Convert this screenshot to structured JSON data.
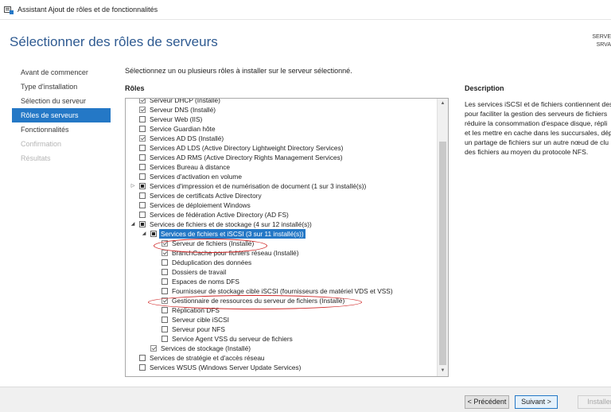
{
  "window": {
    "title": "Assistant Ajout de rôles et de fonctionnalités"
  },
  "header": {
    "page_title": "Sélectionner des rôles de serveurs",
    "server_line1": "SERVE",
    "server_line2": "SRVA"
  },
  "nav": {
    "items": [
      {
        "label": "Avant de commencer",
        "state": "normal"
      },
      {
        "label": "Type d'installation",
        "state": "normal"
      },
      {
        "label": "Sélection du serveur",
        "state": "normal"
      },
      {
        "label": "Rôles de serveurs",
        "state": "active"
      },
      {
        "label": "Fonctionnalités",
        "state": "normal"
      },
      {
        "label": "Confirmation",
        "state": "disabled"
      },
      {
        "label": "Résultats",
        "state": "disabled"
      }
    ]
  },
  "main": {
    "instruction": "Sélectionnez un ou plusieurs rôles à installer sur le serveur sélectionné.",
    "roles_label": "Rôles"
  },
  "roles": [
    {
      "label": "Serveur DHCP (Installé)",
      "level": 0,
      "state": "checked",
      "expander": ""
    },
    {
      "label": "Serveur DNS (Installé)",
      "level": 0,
      "state": "checked",
      "expander": ""
    },
    {
      "label": "Serveur Web (IIS)",
      "level": 0,
      "state": "unchecked",
      "expander": ""
    },
    {
      "label": "Service Guardian hôte",
      "level": 0,
      "state": "unchecked",
      "expander": ""
    },
    {
      "label": "Services AD DS (Installé)",
      "level": 0,
      "state": "checked",
      "expander": ""
    },
    {
      "label": "Services AD LDS (Active Directory Lightweight Directory Services)",
      "level": 0,
      "state": "unchecked",
      "expander": ""
    },
    {
      "label": "Services AD RMS (Active Directory Rights Management Services)",
      "level": 0,
      "state": "unchecked",
      "expander": ""
    },
    {
      "label": "Services Bureau à distance",
      "level": 0,
      "state": "unchecked",
      "expander": ""
    },
    {
      "label": "Services d'activation en volume",
      "level": 0,
      "state": "unchecked",
      "expander": ""
    },
    {
      "label": "Services d'impression et de numérisation de document (1 sur 3 installé(s))",
      "level": 0,
      "state": "partial",
      "expander": "▷"
    },
    {
      "label": "Services de certificats Active Directory",
      "level": 0,
      "state": "unchecked",
      "expander": ""
    },
    {
      "label": "Services de déploiement Windows",
      "level": 0,
      "state": "unchecked",
      "expander": ""
    },
    {
      "label": "Services de fédération Active Directory (AD FS)",
      "level": 0,
      "state": "unchecked",
      "expander": ""
    },
    {
      "label": "Services de fichiers et de stockage (4 sur 12 installé(s))",
      "level": 0,
      "state": "partial",
      "expander": "◢"
    },
    {
      "label": "Services de fichiers et iSCSI (3 sur 11 installé(s))",
      "level": 1,
      "state": "partial",
      "expander": "◢",
      "selected": true
    },
    {
      "label": "Serveur de fichiers (Installé)",
      "level": 2,
      "state": "checked",
      "expander": ""
    },
    {
      "label": "BranchCache pour fichiers réseau (Installé)",
      "level": 2,
      "state": "checked",
      "expander": ""
    },
    {
      "label": "Déduplication des données",
      "level": 2,
      "state": "unchecked",
      "expander": ""
    },
    {
      "label": "Dossiers de travail",
      "level": 2,
      "state": "unchecked",
      "expander": ""
    },
    {
      "label": "Espaces de noms DFS",
      "level": 2,
      "state": "unchecked",
      "expander": ""
    },
    {
      "label": "Fournisseur de stockage cible iSCSI (fournisseurs de matériel VDS et VSS)",
      "level": 2,
      "state": "unchecked",
      "expander": ""
    },
    {
      "label": "Gestionnaire de ressources du serveur de fichiers (Installé)",
      "level": 2,
      "state": "checked",
      "expander": ""
    },
    {
      "label": "Réplication DFS",
      "level": 2,
      "state": "unchecked",
      "expander": ""
    },
    {
      "label": "Serveur cible iSCSI",
      "level": 2,
      "state": "unchecked",
      "expander": ""
    },
    {
      "label": "Serveur pour NFS",
      "level": 2,
      "state": "unchecked",
      "expander": ""
    },
    {
      "label": "Service Agent VSS du serveur de fichiers",
      "level": 2,
      "state": "unchecked",
      "expander": ""
    },
    {
      "label": "Services de stockage (Installé)",
      "level": 1,
      "state": "checked",
      "expander": ""
    },
    {
      "label": "Services de stratégie et d'accès réseau",
      "level": 0,
      "state": "unchecked",
      "expander": ""
    },
    {
      "label": "Services WSUS (Windows Server Update Services)",
      "level": 0,
      "state": "unchecked",
      "expander": ""
    }
  ],
  "description": {
    "title": "Description",
    "lines": [
      "Les services iSCSI et de fichiers contiennent des",
      "pour faciliter la gestion des serveurs de fichiers",
      "réduire la consommation d'espace disque, répli",
      "et les mettre en cache dans les succursales, dép",
      "un partage de fichiers sur un autre nœud de clu",
      "des fichiers au moyen du protocole NFS."
    ]
  },
  "footer": {
    "prev_label": "< Précédent",
    "next_label": "Suivant >",
    "install_label": "Installer"
  },
  "colors": {
    "accent": "#2478c6",
    "title": "#2e5a91",
    "highlight_ring": "#d12b2b"
  }
}
